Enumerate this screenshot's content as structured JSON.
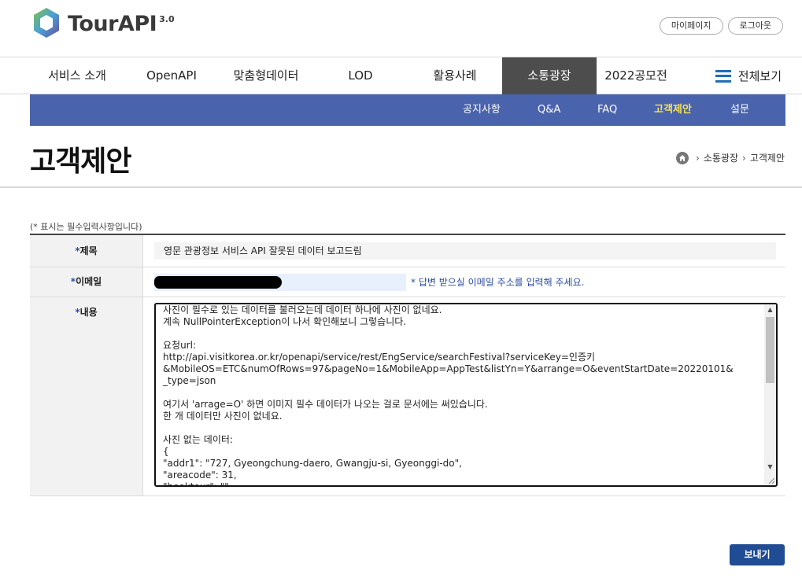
{
  "header": {
    "logo_text": "TourAPI",
    "logo_version": "3.0",
    "mypage_label": "마이페이지",
    "logout_label": "로그아웃"
  },
  "gnb": {
    "items": [
      "서비스 소개",
      "OpenAPI",
      "맞춤형데이터",
      "LOD",
      "활용사례",
      "소통광장",
      "2022공모전"
    ],
    "active_index": 5,
    "all_label": "전체보기"
  },
  "subnav": {
    "items": [
      "공지사항",
      "Q&A",
      "FAQ",
      "고객제안",
      "설문"
    ],
    "active_index": 3
  },
  "page": {
    "title": "고객제안",
    "breadcrumb": [
      "소통광장",
      "고객제안"
    ]
  },
  "form": {
    "required_note": "(* 표시는 필수입력사항입니다)",
    "subject_label": "제목",
    "subject_value": "영문 관광정보 서비스 API 잘못된 데이터 보고드림",
    "email_label": "이메일",
    "email_hint": "* 답변 받으실 이메일 주소를 입력해 주세요.",
    "content_label": "내용",
    "content_value": "사진이 필수로 있는 데이터를 불러오는데 데이터 하나에 사진이 없네요.\n계속 NullPointerException이 나서 확인해보니 그렇습니다.\n\n요청url:\nhttp://api.visitkorea.or.kr/openapi/service/rest/EngService/searchFestival?serviceKey=인증키\n&MobileOS=ETC&numOfRows=97&pageNo=1&MobileApp=AppTest&listYn=Y&arrange=O&eventStartDate=20220101&\n_type=json\n\n여기서 'arrage=O' 하면 이미지 필수 데이터가 나오는 걸로 문서에는 써있습니다.\n한 개 데이터만 사진이 없네요.\n\n사진 없는 데이터:\n{\n\"addr1\": \"727, Gyeongchung-daero, Gwangju-si, Gyeonggi-do\",\n\"areacode\": 31,\n\"booktour\": \"\",",
    "required_mark": "*",
    "submit_label": "보내기"
  },
  "colors": {
    "subnav_bg": "#4a63ad",
    "subnav_active": "#f3e25a",
    "gnb_active_bg": "#4d4d4d",
    "submit_bg": "#1f4c93",
    "hint_text": "#2b4ea2"
  }
}
